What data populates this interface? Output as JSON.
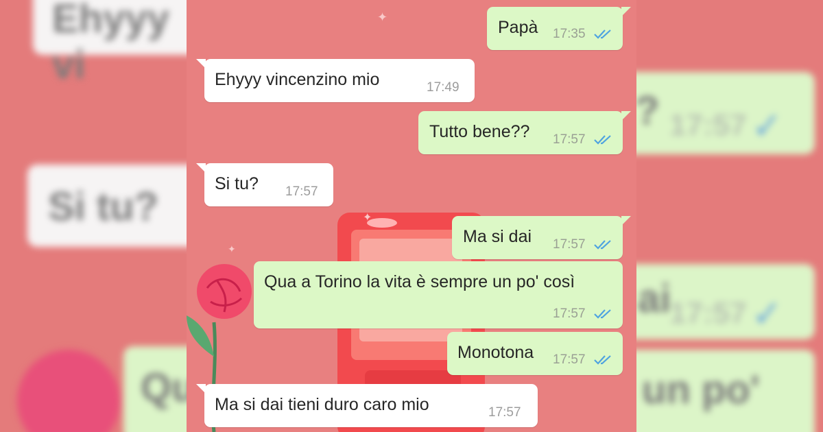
{
  "theme": {
    "background": "#e57c7c",
    "incoming_bubble": "#ffffff",
    "outgoing_bubble": "#dcf8c6",
    "read_checks": "#4fa3e0"
  },
  "messages": [
    {
      "direction": "out",
      "text": "Papà",
      "time": "17:35",
      "status": "read-double-check-icon"
    },
    {
      "direction": "in",
      "text": "Ehyyy vincenzino mio",
      "time": "17:49"
    },
    {
      "direction": "out",
      "text": "Tutto bene??",
      "time": "17:57",
      "status": "read-double-check-icon"
    },
    {
      "direction": "in",
      "text": "Si tu?",
      "time": "17:57"
    },
    {
      "direction": "out",
      "text": "Ma si dai",
      "time": "17:57",
      "status": "read-double-check-icon"
    },
    {
      "direction": "out",
      "text": "Qua a Torino la vita è sempre un po' così",
      "time": "17:57",
      "status": "read-double-check-icon"
    },
    {
      "direction": "out",
      "text": "Monotona",
      "time": "17:57",
      "status": "read-double-check-icon"
    },
    {
      "direction": "in",
      "text": "Ma si dai tieni duro caro mio",
      "time": "17:57"
    }
  ],
  "background_decor": [
    "rose-illustration",
    "red-device-illustration",
    "sparkle-icon"
  ]
}
